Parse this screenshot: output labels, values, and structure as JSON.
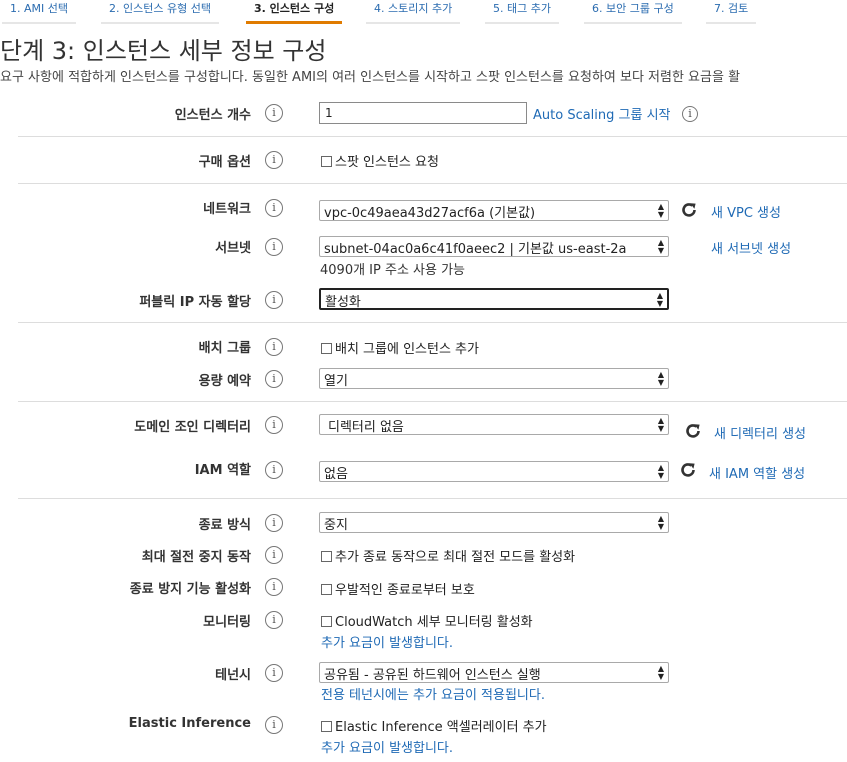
{
  "tabs": [
    {
      "label": "1. AMI 선택"
    },
    {
      "label": "2. 인스턴스 유형 선택"
    },
    {
      "label": "3. 인스턴스 구성"
    },
    {
      "label": "4. 스토리지 추가"
    },
    {
      "label": "5. 태그 추가"
    },
    {
      "label": "6. 보안 그룹 구성"
    },
    {
      "label": "7. 검토"
    }
  ],
  "page": {
    "title": "단계 3: 인스턴스 세부 정보 구성",
    "description": "요구 사항에 적합하게 인스턴스를 구성합니다. 동일한 AMI의 여러 인스턴스를 시작하고 스팟 인스턴스를 요청하여 보다 저렴한 요금을 활"
  },
  "info_icon": "i",
  "fields": {
    "instance_count": {
      "label": "인스턴스 개수",
      "value": "1",
      "link": "Auto Scaling 그룹 시작"
    },
    "purchase_option": {
      "label": "구매 옵션",
      "checkbox": "스팟 인스턴스 요청"
    },
    "network": {
      "label": "네트워크",
      "value": "vpc-0c49aea43d27acf6a (기본값)",
      "link": "새 VPC 생성"
    },
    "subnet": {
      "label": "서브넷",
      "value": "subnet-04ac0a6c41f0aeec2 | 기본값 us-east-2a",
      "note": "4090개 IP 주소 사용 가능",
      "link": "새 서브넷 생성"
    },
    "public_ip": {
      "label": "퍼블릭 IP 자동 할당",
      "value": "활성화"
    },
    "placement_group": {
      "label": "배치 그룹",
      "checkbox": "배치 그룹에 인스턴스 추가"
    },
    "capacity_reservation": {
      "label": "용량 예약",
      "value": "열기"
    },
    "domain_join": {
      "label": "도메인 조인 디렉터리",
      "value": "디렉터리 없음",
      "link": "새 디렉터리 생성"
    },
    "iam_role": {
      "label": "IAM 역할",
      "value": "없음",
      "link": "새 IAM 역할 생성"
    },
    "shutdown_behavior": {
      "label": "종료 방식",
      "value": "중지"
    },
    "stop_hibernate": {
      "label": "최대 절전 중지 동작",
      "checkbox": "추가 종료 동작으로 최대 절전 모드를 활성화"
    },
    "termination_protection": {
      "label": "종료 방지 기능 활성화",
      "checkbox": "우발적인 종료로부터 보호"
    },
    "monitoring": {
      "label": "모니터링",
      "checkbox": "CloudWatch 세부 모니터링 활성화",
      "link": "추가 요금이 발생합니다."
    },
    "tenancy": {
      "label": "테넌시",
      "value": "공유됨 - 공유된 하드웨어 인스턴스 실행",
      "link": "전용 테넌시에는 추가 요금이 적용됩니다."
    },
    "elastic_inference": {
      "label": "Elastic Inference",
      "checkbox": "Elastic Inference 액셀러레이터 추가",
      "link": "추가 요금이 발생합니다."
    }
  },
  "colors": {
    "link": "#1f6ab5",
    "active_tab_underline": "#e07b00"
  }
}
